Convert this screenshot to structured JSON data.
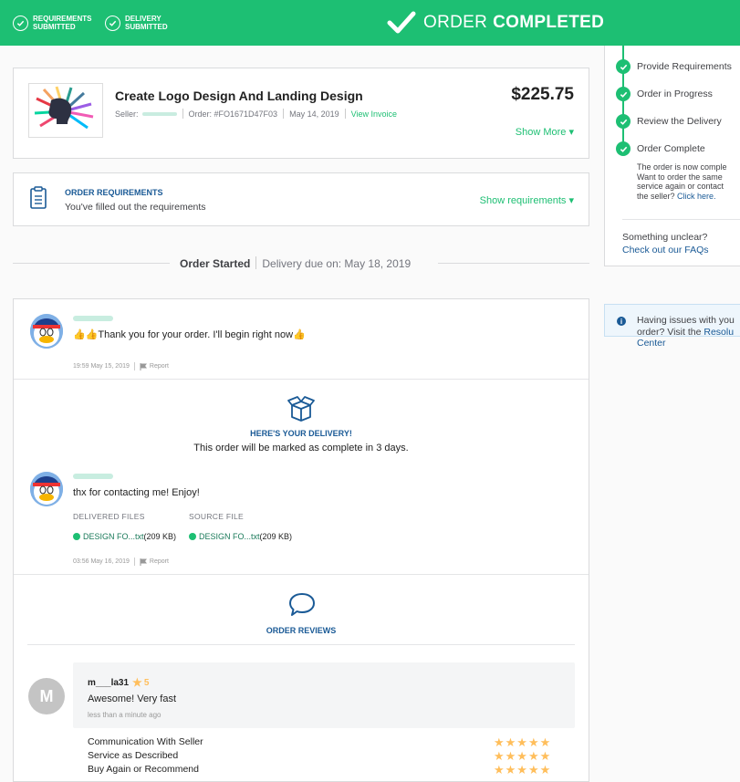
{
  "header": {
    "step1": "REQUIREMENTS SUBMITTED",
    "step1_line1": "REQUIREMENTS",
    "step1_line2": "SUBMITTED",
    "step2_line1": "DELIVERY",
    "step2_line2": "SUBMITTED",
    "status_light": "ORDER",
    "status_bold": "COMPLETED",
    "accent_color": "#1dbf73"
  },
  "order": {
    "title": "Create Logo Design And Landing Design",
    "seller_label": "Seller:",
    "order_label": "Order: #FO1671D47F03",
    "date": "May 14, 2019",
    "invoice_link": "View Invoice",
    "price": "$225.75",
    "show_more": "Show More ▾"
  },
  "requirements": {
    "title": "ORDER REQUIREMENTS",
    "subtitle": "You've filled out the requirements",
    "toggle": "Show requirements ▾"
  },
  "timeline_divider": {
    "started": "Order Started",
    "due": "Delivery due on: May 18, 2019"
  },
  "message1": {
    "text": "👍👍Thank you for your order. I'll begin right now👍",
    "time": "19:59 May 15, 2019",
    "report": "Report"
  },
  "delivery": {
    "title": "HERE'S YOUR DELIVERY!",
    "subtitle": "This order will be marked as complete in 3 days.",
    "message": "thx for contacting me! Enjoy!",
    "delivered_label": "DELIVERED FILES",
    "source_label": "SOURCE FILE",
    "file1_name": "DESIGN FO...txt",
    "file1_size": " (209 KB)",
    "file2_name": "DESIGN FO...txt",
    "file2_size": " (209 KB)",
    "time": "03:56 May 16, 2019",
    "report": "Report"
  },
  "reviews": {
    "title": "ORDER REVIEWS",
    "avatar_letter": "M",
    "reviewer": "m___la31",
    "rating": "5",
    "text": "Awesome! Very fast",
    "time": "less than a minute ago",
    "criteria": [
      {
        "label": "Communication With Seller",
        "stars": 5
      },
      {
        "label": "Service as Described",
        "stars": 5
      },
      {
        "label": "Buy Again or Recommend",
        "stars": 5
      }
    ]
  },
  "sidebar": {
    "steps": [
      {
        "label": "Provide Requirements"
      },
      {
        "label": "Order in Progress"
      },
      {
        "label": "Review the Delivery"
      },
      {
        "label": "Order Complete"
      }
    ],
    "complete_note": "The order is now comple... Want to order the same service again or contact the seller?",
    "note_line1": "The order is now comple",
    "note_line2": "Want to order the same",
    "note_line3": "service again or contact",
    "note_line4": "the seller?",
    "click_here": "Click here.",
    "unclear": "Something unclear?",
    "faq_link": "Check out our FAQs",
    "issue_text": "Having issues with you order? Visit the",
    "issue_line1": "Having issues with you",
    "issue_line2": "order? Visit the",
    "resolution_link1": "Resolu",
    "resolution_link2": "Center"
  }
}
